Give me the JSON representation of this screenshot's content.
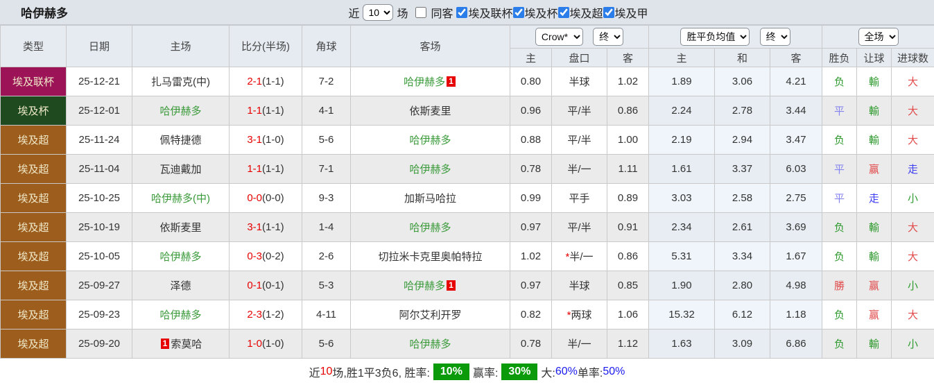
{
  "title": "哈伊赫多",
  "controls": {
    "near_label": "近",
    "matches_select": "10",
    "matches_label": "场",
    "same_away": {
      "label": "同客",
      "checked": false
    },
    "leagues": [
      {
        "label": "埃及联杯",
        "checked": true
      },
      {
        "label": "埃及杯",
        "checked": true
      },
      {
        "label": "埃及超",
        "checked": true
      },
      {
        "label": "埃及甲",
        "checked": true
      }
    ]
  },
  "header": {
    "columns": [
      "类型",
      "日期",
      "主场",
      "比分(半场)",
      "角球",
      "客场"
    ],
    "odds_group": {
      "select1": "Crow*",
      "select2": "终",
      "sub": [
        "主",
        "盘口",
        "客"
      ]
    },
    "avg_group": {
      "select1": "胜平负均值",
      "select2": "终",
      "sub": [
        "主",
        "和",
        "客"
      ]
    },
    "result_group": {
      "select": "全场",
      "sub": [
        "胜负",
        "让球",
        "进球数"
      ]
    }
  },
  "league_colors": {
    "埃及联杯": "#9c1457",
    "埃及杯": "#1f4a1f",
    "埃及超": "#9d5d1d"
  },
  "rows": [
    {
      "league": "埃及联杯",
      "date": "25-12-21",
      "home": {
        "name": "扎马雷克(中)",
        "green": false
      },
      "score": {
        "ft": "2-1",
        "ht": "(1-1)"
      },
      "corner": "7-2",
      "away": {
        "name": "哈伊赫多",
        "green": true,
        "badge": "1",
        "badge_pos": "after"
      },
      "odds": {
        "home": "0.80",
        "handicap": "半球",
        "star": false,
        "away": "1.02"
      },
      "avg": {
        "home": "1.89",
        "draw": "3.06",
        "away": "4.21"
      },
      "result": {
        "wdl": {
          "t": "负",
          "c": "g"
        },
        "handicap": {
          "t": "輸",
          "c": "g"
        },
        "goals": {
          "t": "大",
          "c": "r"
        }
      }
    },
    {
      "league": "埃及杯",
      "date": "25-12-01",
      "home": {
        "name": "哈伊赫多",
        "green": true
      },
      "score": {
        "ft": "1-1",
        "ht": "(1-1)"
      },
      "corner": "4-1",
      "away": {
        "name": "依斯麦里",
        "green": false
      },
      "odds": {
        "home": "0.96",
        "handicap": "平/半",
        "star": false,
        "away": "0.86"
      },
      "avg": {
        "home": "2.24",
        "draw": "2.78",
        "away": "3.44"
      },
      "result": {
        "wdl": {
          "t": "平",
          "c": "v"
        },
        "handicap": {
          "t": "輸",
          "c": "g"
        },
        "goals": {
          "t": "大",
          "c": "r"
        }
      }
    },
    {
      "league": "埃及超",
      "date": "25-11-24",
      "home": {
        "name": "佩特捷德",
        "green": false
      },
      "score": {
        "ft": "3-1",
        "ht": "(1-0)"
      },
      "corner": "5-6",
      "away": {
        "name": "哈伊赫多",
        "green": true
      },
      "odds": {
        "home": "0.88",
        "handicap": "平/半",
        "star": false,
        "away": "1.00"
      },
      "avg": {
        "home": "2.19",
        "draw": "2.94",
        "away": "3.47"
      },
      "result": {
        "wdl": {
          "t": "负",
          "c": "g"
        },
        "handicap": {
          "t": "輸",
          "c": "g"
        },
        "goals": {
          "t": "大",
          "c": "r"
        }
      }
    },
    {
      "league": "埃及超",
      "date": "25-11-04",
      "home": {
        "name": "瓦迪戴加",
        "green": false
      },
      "score": {
        "ft": "1-1",
        "ht": "(1-1)"
      },
      "corner": "7-1",
      "away": {
        "name": "哈伊赫多",
        "green": true
      },
      "odds": {
        "home": "0.78",
        "handicap": "半/一",
        "star": false,
        "away": "1.11"
      },
      "avg": {
        "home": "1.61",
        "draw": "3.37",
        "away": "6.03"
      },
      "result": {
        "wdl": {
          "t": "平",
          "c": "v"
        },
        "handicap": {
          "t": "赢",
          "c": "r"
        },
        "goals": {
          "t": "走",
          "c": "b"
        }
      }
    },
    {
      "league": "埃及超",
      "date": "25-10-25",
      "home": {
        "name": "哈伊赫多(中)",
        "green": true
      },
      "score": {
        "ft": "0-0",
        "ht": "(0-0)"
      },
      "corner": "9-3",
      "away": {
        "name": "加斯马哈拉",
        "green": false
      },
      "odds": {
        "home": "0.99",
        "handicap": "平手",
        "star": false,
        "away": "0.89"
      },
      "avg": {
        "home": "3.03",
        "draw": "2.58",
        "away": "2.75"
      },
      "result": {
        "wdl": {
          "t": "平",
          "c": "v"
        },
        "handicap": {
          "t": "走",
          "c": "b"
        },
        "goals": {
          "t": "小",
          "c": "g"
        }
      }
    },
    {
      "league": "埃及超",
      "date": "25-10-19",
      "home": {
        "name": "依斯麦里",
        "green": false
      },
      "score": {
        "ft": "3-1",
        "ht": "(1-1)"
      },
      "corner": "1-4",
      "away": {
        "name": "哈伊赫多",
        "green": true
      },
      "odds": {
        "home": "0.97",
        "handicap": "平/半",
        "star": false,
        "away": "0.91"
      },
      "avg": {
        "home": "2.34",
        "draw": "2.61",
        "away": "3.69"
      },
      "result": {
        "wdl": {
          "t": "负",
          "c": "g"
        },
        "handicap": {
          "t": "輸",
          "c": "g"
        },
        "goals": {
          "t": "大",
          "c": "r"
        }
      }
    },
    {
      "league": "埃及超",
      "date": "25-10-05",
      "home": {
        "name": "哈伊赫多",
        "green": true
      },
      "score": {
        "ft": "0-3",
        "ht": "(0-2)"
      },
      "corner": "2-6",
      "away": {
        "name": "切拉米卡克里奥帕特拉",
        "green": false
      },
      "odds": {
        "home": "1.02",
        "handicap": "半/一",
        "star": true,
        "away": "0.86"
      },
      "avg": {
        "home": "5.31",
        "draw": "3.34",
        "away": "1.67"
      },
      "result": {
        "wdl": {
          "t": "负",
          "c": "g"
        },
        "handicap": {
          "t": "輸",
          "c": "g"
        },
        "goals": {
          "t": "大",
          "c": "r"
        }
      }
    },
    {
      "league": "埃及超",
      "date": "25-09-27",
      "home": {
        "name": "泽德",
        "green": false
      },
      "score": {
        "ft": "0-1",
        "ht": "(0-1)"
      },
      "corner": "5-3",
      "away": {
        "name": "哈伊赫多",
        "green": true,
        "badge": "1",
        "badge_pos": "after"
      },
      "odds": {
        "home": "0.97",
        "handicap": "半球",
        "star": false,
        "away": "0.85"
      },
      "avg": {
        "home": "1.90",
        "draw": "2.80",
        "away": "4.98"
      },
      "result": {
        "wdl": {
          "t": "勝",
          "c": "r"
        },
        "handicap": {
          "t": "赢",
          "c": "r"
        },
        "goals": {
          "t": "小",
          "c": "g"
        }
      }
    },
    {
      "league": "埃及超",
      "date": "25-09-23",
      "home": {
        "name": "哈伊赫多",
        "green": true
      },
      "score": {
        "ft": "2-3",
        "ht": "(1-2)"
      },
      "corner": "4-11",
      "away": {
        "name": "阿尔艾利开罗",
        "green": false
      },
      "odds": {
        "home": "0.82",
        "handicap": "两球",
        "star": true,
        "away": "1.06"
      },
      "avg": {
        "home": "15.32",
        "draw": "6.12",
        "away": "1.18"
      },
      "result": {
        "wdl": {
          "t": "负",
          "c": "g"
        },
        "handicap": {
          "t": "赢",
          "c": "r"
        },
        "goals": {
          "t": "大",
          "c": "r"
        }
      }
    },
    {
      "league": "埃及超",
      "date": "25-09-20",
      "home": {
        "name": "索莫哈",
        "green": false,
        "badge": "1",
        "badge_pos": "before"
      },
      "score": {
        "ft": "1-0",
        "ht": "(1-0)"
      },
      "corner": "5-6",
      "away": {
        "name": "哈伊赫多",
        "green": true
      },
      "odds": {
        "home": "0.78",
        "handicap": "半/一",
        "star": false,
        "away": "1.12"
      },
      "avg": {
        "home": "1.63",
        "draw": "3.09",
        "away": "6.86"
      },
      "result": {
        "wdl": {
          "t": "负",
          "c": "g"
        },
        "handicap": {
          "t": "輸",
          "c": "g"
        },
        "goals": {
          "t": "小",
          "c": "g"
        }
      }
    }
  ],
  "footer": {
    "segments": [
      {
        "text": "近",
        "c": "k"
      },
      {
        "text": "10",
        "c": "r"
      },
      {
        "text": "场,胜1平3负6, 胜率:",
        "c": "k"
      },
      {
        "text": "10%",
        "c": "badge"
      },
      {
        "text": " 赢率:",
        "c": "k"
      },
      {
        "text": "30%",
        "c": "badge"
      },
      {
        "text": " 大:",
        "c": "k"
      },
      {
        "text": "60%",
        "c": "b"
      },
      {
        "text": " 单率:",
        "c": "k"
      },
      {
        "text": "50%",
        "c": "b"
      }
    ]
  }
}
